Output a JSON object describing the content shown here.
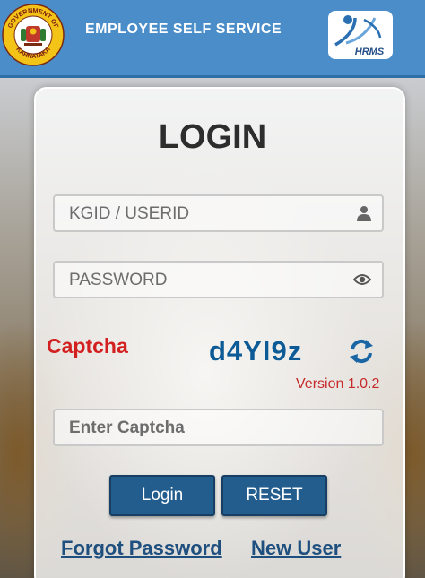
{
  "header": {
    "title": "EMPLOYEE SELF SERVICE",
    "seal_top_text": "GOVERNMENT OF",
    "seal_bottom_text": "KARNATAKA",
    "hrms_logo_text": "HRMS",
    "color": "#4a8dc9"
  },
  "login": {
    "title": "LOGIN",
    "userid_placeholder": "KGID / USERID",
    "password_placeholder": "PASSWORD",
    "captcha_label": "Captcha",
    "captcha_code": "d4Yl9z",
    "version": "Version 1.0.2",
    "captcha_input_placeholder": "Enter Captcha",
    "login_button": "Login",
    "reset_button": "RESET",
    "forgot_link": "Forgot Password",
    "new_user_link": "New User"
  },
  "icons": {
    "user": "user-icon",
    "eye": "eye-icon",
    "refresh": "refresh-icon"
  },
  "colors": {
    "button": "#235d8e",
    "captcha_label": "#d21f1f",
    "captcha_code": "#0c5b96"
  }
}
